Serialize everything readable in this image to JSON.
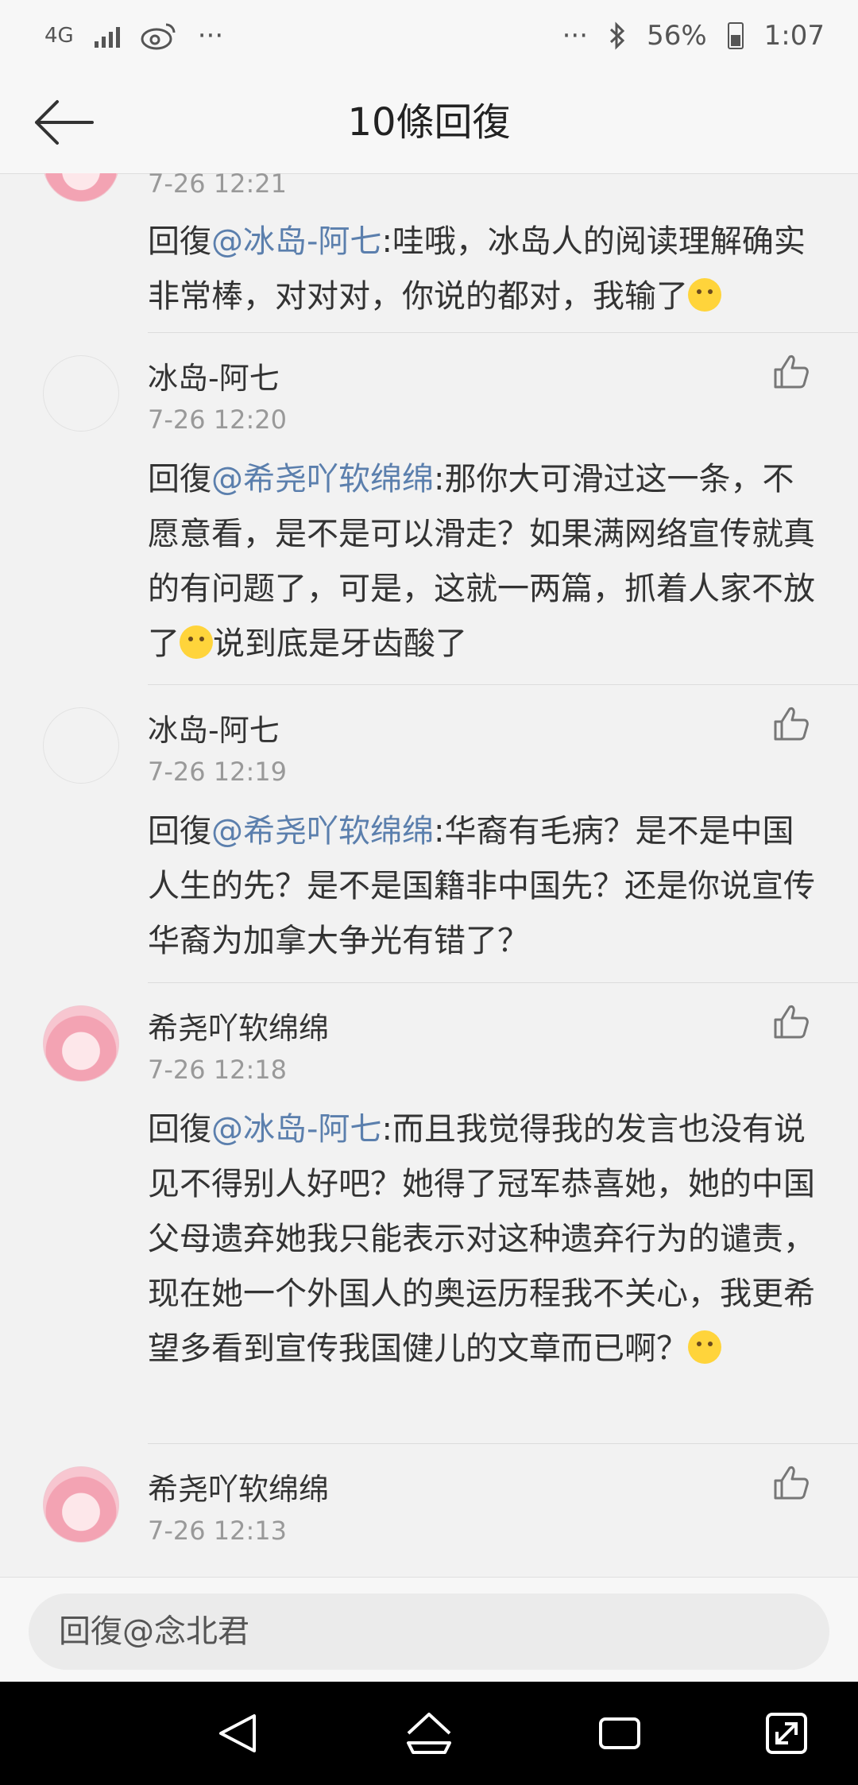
{
  "status_bar": {
    "network": "4G",
    "network_sub": "G",
    "time": "1:07",
    "battery": "56%",
    "more_left": "···",
    "more_right": "···"
  },
  "header": {
    "title": "10條回復",
    "back_icon": "back-arrow-icon"
  },
  "comments": [
    {
      "name": "",
      "time": "7-26 12:21",
      "prefix": "回復",
      "mention": "@冰岛-阿七",
      "text": ":哇哦，冰岛人的阅读理解确实非常棒，对对对，你说的都对，我输了",
      "emoji": "flushed-emoji-icon",
      "avatar": "pink"
    },
    {
      "name": "冰岛-阿七",
      "time": "7-26 12:20",
      "prefix": "回復",
      "mention": "@希尧吖软绵绵",
      "text": ":那你大可滑过这一条，不愿意看，是不是可以滑走？如果满网络宣传就真的有问题了，可是，这就一两篇，抓着人家不放了",
      "text_tail": "说到底是牙齿酸了",
      "emoji": "thinking-emoji-icon",
      "avatar": "blank"
    },
    {
      "name": "冰岛-阿七",
      "time": "7-26 12:19",
      "prefix": "回復",
      "mention": "@希尧吖软绵绵",
      "text": ":华裔有毛病？是不是中国人生的先？是不是国籍非中国先？还是你说宣传华裔为加拿大争光有错了？",
      "avatar": "blank"
    },
    {
      "name": "希尧吖软绵绵",
      "time": "7-26 12:18",
      "prefix": "回復",
      "mention": "@冰岛-阿七",
      "text": ":而且我觉得我的发言也没有说见不得别人好吧？她得了冠军恭喜她，她的中国父母遗弃她我只能表示对这种遗弃行为的谴责，现在她一个外国人的奥运历程我不关心，我更希望多看到宣传我国健儿的文章而已啊？",
      "emoji": "thinking-emoji-icon",
      "avatar": "pink"
    },
    {
      "name": "希尧吖软绵绵",
      "time": "7-26 12:13",
      "prefix": "",
      "mention": "",
      "text": "",
      "avatar": "pink"
    }
  ],
  "reply_bar": {
    "placeholder": "回復@念北君"
  },
  "navbar": {
    "icons": [
      "back-triangle-icon",
      "home-icon",
      "recents-icon",
      "expand-icon"
    ]
  }
}
